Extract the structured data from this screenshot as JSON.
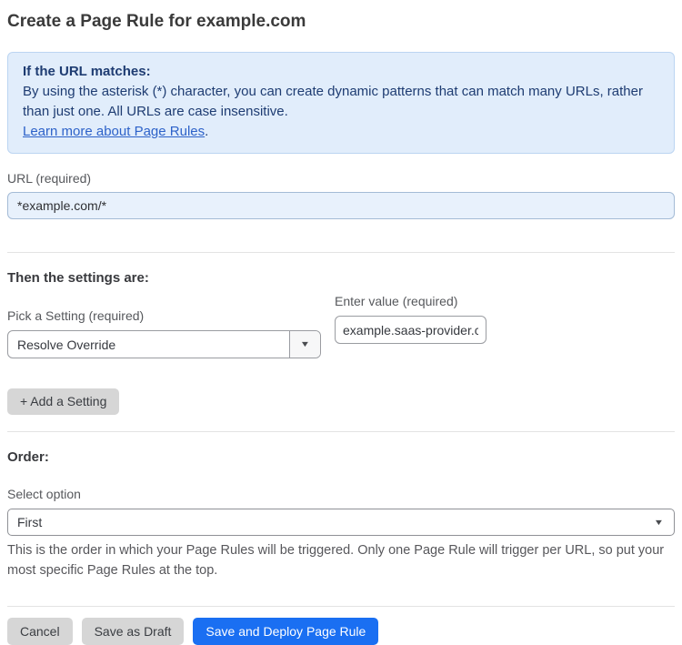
{
  "page": {
    "title": "Create a Page Rule for example.com"
  },
  "info_box": {
    "heading": "If the URL matches:",
    "body": "By using the asterisk (*) character, you can create dynamic patterns that can match many URLs, rather than just one. All URLs are case insensitive.",
    "link_label": "Learn more about Page Rules",
    "link_suffix": "."
  },
  "url_field": {
    "label": "URL (required)",
    "value": "*example.com/*"
  },
  "settings_section": {
    "heading": "Then the settings are:",
    "setting_label": "Pick a Setting (required)",
    "setting_selected": "Resolve Override",
    "value_label": "Enter value (required)",
    "value_text": "example.saas-provider.c",
    "add_setting_label": "+ Add a Setting"
  },
  "order_section": {
    "heading": "Order:",
    "select_label": "Select option",
    "select_selected": "First",
    "help_text": "This is the order in which your Page Rules will be triggered. Only one Page Rule will trigger per URL, so put your most specific Page Rules at the top."
  },
  "actions": {
    "cancel_label": "Cancel",
    "save_draft_label": "Save as Draft",
    "save_deploy_label": "Save and Deploy Page Rule"
  },
  "icons": {
    "dropdown_caret": "▼"
  },
  "colors": {
    "primary_blue": "#1a6ff2",
    "info_bg": "#e1edfb",
    "info_border": "#bcd5f2",
    "info_text": "#1e3c72",
    "link_blue": "#2d62c9",
    "url_input_bg": "#e8f1fc",
    "button_gray": "#d6d6d6"
  }
}
